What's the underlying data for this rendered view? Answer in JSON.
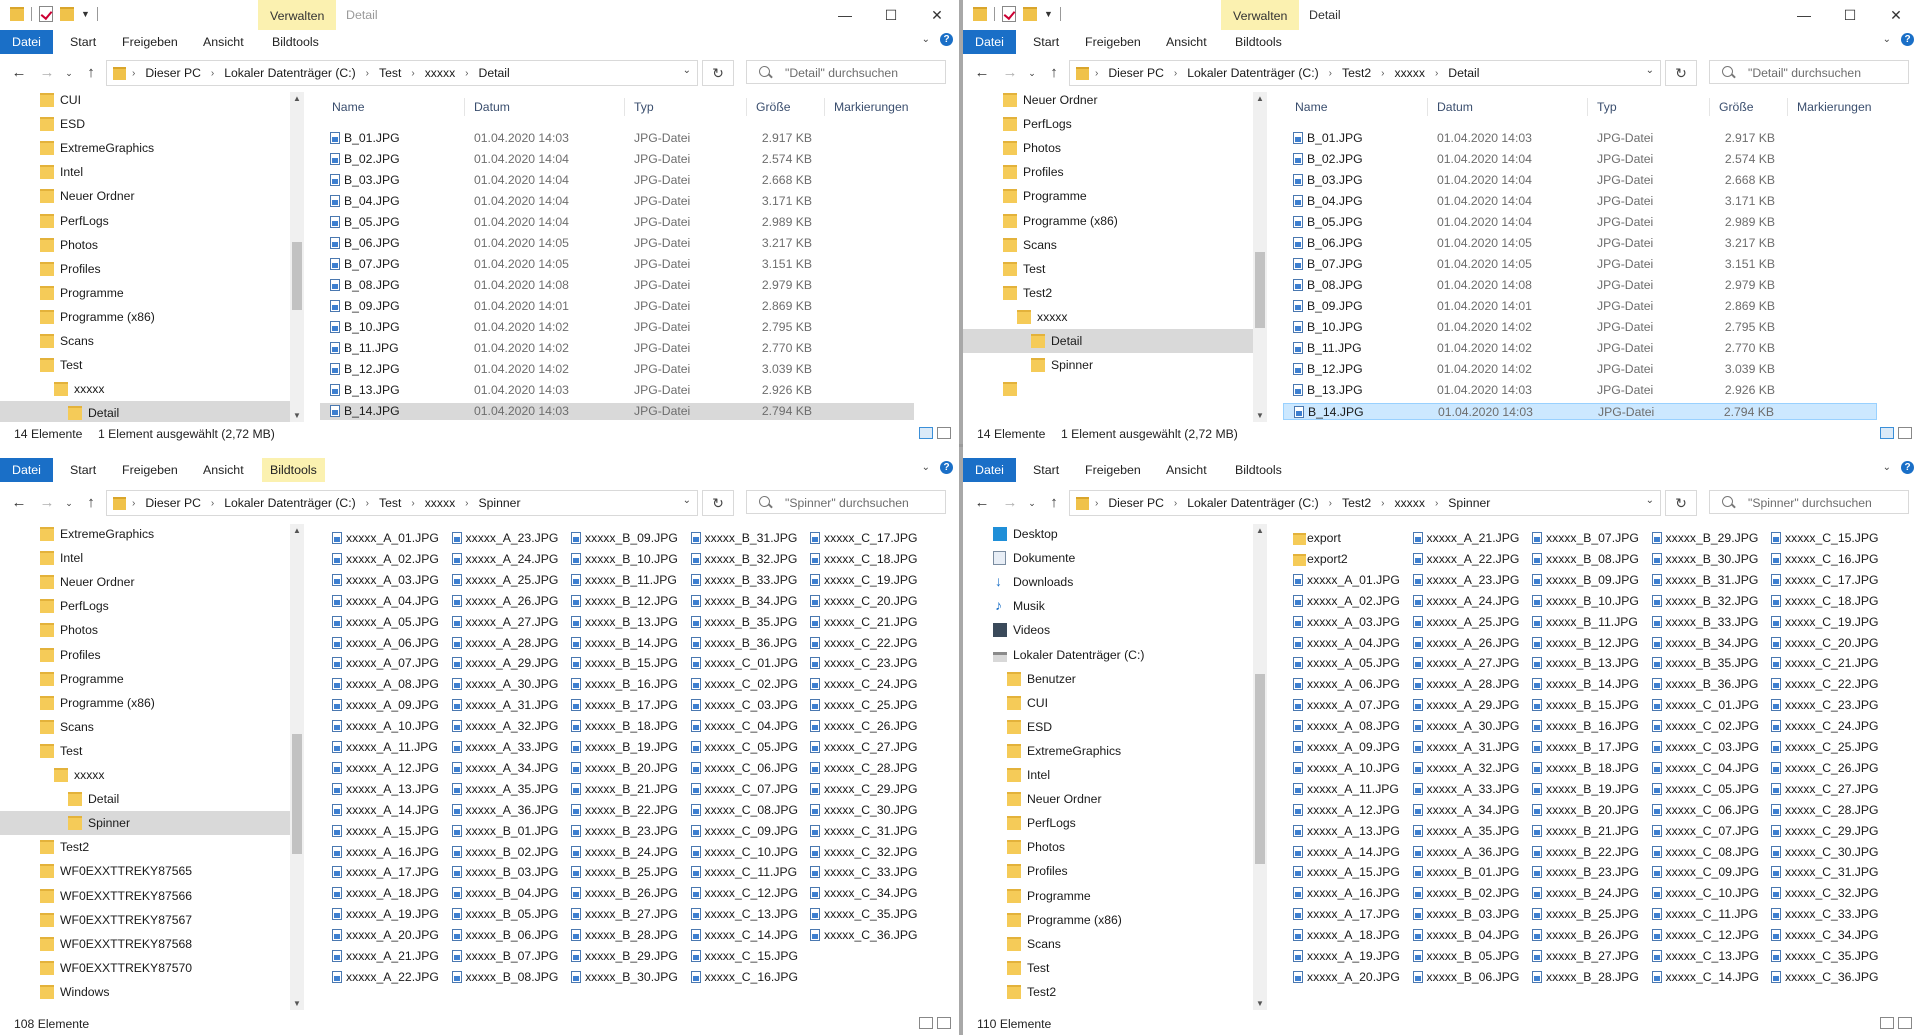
{
  "tabs": {
    "file": "Datei",
    "start": "Start",
    "share": "Freigeben",
    "view": "Ansicht",
    "tools": "Bildtools",
    "manage": "Verwalten"
  },
  "columns": {
    "name": "Name",
    "date": "Datum",
    "type": "Typ",
    "size": "Größe",
    "tags": "Markierungen"
  },
  "address_root": [
    "Dieser PC",
    "Lokaler Datenträger (C:)"
  ],
  "windows": [
    {
      "key": "tl",
      "title": "Detail",
      "address": [
        "Test",
        "xxxxx",
        "Detail"
      ],
      "search_placeholder": "\"Detail\" durchsuchen",
      "status_count": "14 Elemente",
      "status_selected": "1 Element ausgewählt (2,72 MB)",
      "nav": [
        {
          "label": "CUI",
          "indent": 0
        },
        {
          "label": "ESD",
          "indent": 0
        },
        {
          "label": "ExtremeGraphics",
          "indent": 0
        },
        {
          "label": "Intel",
          "indent": 0
        },
        {
          "label": "Neuer Ordner",
          "indent": 0
        },
        {
          "label": "PerfLogs",
          "indent": 0
        },
        {
          "label": "Photos",
          "indent": 0
        },
        {
          "label": "Profiles",
          "indent": 0
        },
        {
          "label": "Programme",
          "indent": 0
        },
        {
          "label": "Programme (x86)",
          "indent": 0
        },
        {
          "label": "Scans",
          "indent": 0
        },
        {
          "label": "Test",
          "indent": 0
        },
        {
          "label": "xxxxx",
          "indent": 1
        },
        {
          "label": "Detail",
          "indent": 2,
          "selected": true
        }
      ]
    },
    {
      "key": "tr",
      "title": "Detail",
      "address": [
        "Test2",
        "xxxxx",
        "Detail"
      ],
      "search_placeholder": "\"Detail\" durchsuchen",
      "status_count": "14 Elemente",
      "status_selected": "1 Element ausgewählt (2,72 MB)",
      "nav": [
        {
          "label": "Neuer Ordner",
          "indent": 0
        },
        {
          "label": "PerfLogs",
          "indent": 0
        },
        {
          "label": "Photos",
          "indent": 0
        },
        {
          "label": "Profiles",
          "indent": 0
        },
        {
          "label": "Programme",
          "indent": 0
        },
        {
          "label": "Programme (x86)",
          "indent": 0
        },
        {
          "label": "Scans",
          "indent": 0
        },
        {
          "label": "Test",
          "indent": 0
        },
        {
          "label": "Test2",
          "indent": 0
        },
        {
          "label": "xxxxx",
          "indent": 1
        },
        {
          "label": "Detail",
          "indent": 2,
          "selected": true
        },
        {
          "label": "Spinner",
          "indent": 2
        },
        {
          "label": "",
          "indent": 0
        }
      ]
    },
    {
      "key": "bl",
      "title": "Spinner",
      "address": [
        "Test",
        "xxxxx",
        "Spinner"
      ],
      "search_placeholder": "\"Spinner\" durchsuchen",
      "status_count": "108 Elemente",
      "status_selected": "",
      "nav": [
        {
          "label": "ExtremeGraphics",
          "indent": 0
        },
        {
          "label": "Intel",
          "indent": 0
        },
        {
          "label": "Neuer Ordner",
          "indent": 0
        },
        {
          "label": "PerfLogs",
          "indent": 0
        },
        {
          "label": "Photos",
          "indent": 0
        },
        {
          "label": "Profiles",
          "indent": 0
        },
        {
          "label": "Programme",
          "indent": 0
        },
        {
          "label": "Programme (x86)",
          "indent": 0
        },
        {
          "label": "Scans",
          "indent": 0
        },
        {
          "label": "Test",
          "indent": 0
        },
        {
          "label": "xxxxx",
          "indent": 1
        },
        {
          "label": "Detail",
          "indent": 2
        },
        {
          "label": "Spinner",
          "indent": 2,
          "selected": true
        },
        {
          "label": "Test2",
          "indent": 0
        },
        {
          "label": "WF0EXXTTREKY87565",
          "indent": 0
        },
        {
          "label": "WF0EXXTTREKY87566",
          "indent": 0
        },
        {
          "label": "WF0EXXTTREKY87567",
          "indent": 0
        },
        {
          "label": "WF0EXXTTREKY87568",
          "indent": 0
        },
        {
          "label": "WF0EXXTTREKY87570",
          "indent": 0
        },
        {
          "label": "Windows",
          "indent": 0
        }
      ]
    },
    {
      "key": "br",
      "title": "Spinner",
      "address": [
        "Test2",
        "xxxxx",
        "Spinner"
      ],
      "search_placeholder": "\"Spinner\" durchsuchen",
      "status_count": "110 Elemente",
      "status_selected": "",
      "nav": [
        {
          "label": "Desktop",
          "indent": 0,
          "icon": "desk"
        },
        {
          "label": "Dokumente",
          "indent": 0,
          "icon": "doc"
        },
        {
          "label": "Downloads",
          "indent": 0,
          "icon": "dl"
        },
        {
          "label": "Musik",
          "indent": 0,
          "icon": "mus"
        },
        {
          "label": "Videos",
          "indent": 0,
          "icon": "vid"
        },
        {
          "label": "Lokaler Datenträger (C:)",
          "indent": 0,
          "icon": "drv"
        },
        {
          "label": "Benutzer",
          "indent": 1
        },
        {
          "label": "CUI",
          "indent": 1
        },
        {
          "label": "ESD",
          "indent": 1
        },
        {
          "label": "ExtremeGraphics",
          "indent": 1
        },
        {
          "label": "Intel",
          "indent": 1
        },
        {
          "label": "Neuer Ordner",
          "indent": 1
        },
        {
          "label": "PerfLogs",
          "indent": 1
        },
        {
          "label": "Photos",
          "indent": 1
        },
        {
          "label": "Profiles",
          "indent": 1
        },
        {
          "label": "Programme",
          "indent": 1
        },
        {
          "label": "Programme (x86)",
          "indent": 1
        },
        {
          "label": "Scans",
          "indent": 1
        },
        {
          "label": "Test",
          "indent": 1
        },
        {
          "label": "Test2",
          "indent": 1
        }
      ]
    }
  ],
  "detail_files": [
    {
      "name": "B_01.JPG",
      "date": "01.04.2020 14:03",
      "type": "JPG-Datei",
      "size": "2.917 KB"
    },
    {
      "name": "B_02.JPG",
      "date": "01.04.2020 14:04",
      "type": "JPG-Datei",
      "size": "2.574 KB"
    },
    {
      "name": "B_03.JPG",
      "date": "01.04.2020 14:04",
      "type": "JPG-Datei",
      "size": "2.668 KB"
    },
    {
      "name": "B_04.JPG",
      "date": "01.04.2020 14:04",
      "type": "JPG-Datei",
      "size": "3.171 KB"
    },
    {
      "name": "B_05.JPG",
      "date": "01.04.2020 14:04",
      "type": "JPG-Datei",
      "size": "2.989 KB"
    },
    {
      "name": "B_06.JPG",
      "date": "01.04.2020 14:05",
      "type": "JPG-Datei",
      "size": "3.217 KB"
    },
    {
      "name": "B_07.JPG",
      "date": "01.04.2020 14:05",
      "type": "JPG-Datei",
      "size": "3.151 KB"
    },
    {
      "name": "B_08.JPG",
      "date": "01.04.2020 14:08",
      "type": "JPG-Datei",
      "size": "2.979 KB"
    },
    {
      "name": "B_09.JPG",
      "date": "01.04.2020 14:01",
      "type": "JPG-Datei",
      "size": "2.869 KB"
    },
    {
      "name": "B_10.JPG",
      "date": "01.04.2020 14:02",
      "type": "JPG-Datei",
      "size": "2.795 KB"
    },
    {
      "name": "B_11.JPG",
      "date": "01.04.2020 14:02",
      "type": "JPG-Datei",
      "size": "2.770 KB"
    },
    {
      "name": "B_12.JPG",
      "date": "01.04.2020 14:02",
      "type": "JPG-Datei",
      "size": "3.039 KB"
    },
    {
      "name": "B_13.JPG",
      "date": "01.04.2020 14:03",
      "type": "JPG-Datei",
      "size": "2.926 KB"
    },
    {
      "name": "B_14.JPG",
      "date": "01.04.2020 14:03",
      "type": "JPG-Datei",
      "size": "2.794 KB"
    }
  ],
  "spinner_bl": [
    [
      "xxxxx_A_01.JPG",
      "xxxxx_A_02.JPG",
      "xxxxx_A_03.JPG",
      "xxxxx_A_04.JPG",
      "xxxxx_A_05.JPG",
      "xxxxx_A_06.JPG",
      "xxxxx_A_07.JPG",
      "xxxxx_A_08.JPG",
      "xxxxx_A_09.JPG",
      "xxxxx_A_10.JPG",
      "xxxxx_A_11.JPG",
      "xxxxx_A_12.JPG",
      "xxxxx_A_13.JPG",
      "xxxxx_A_14.JPG",
      "xxxxx_A_15.JPG",
      "xxxxx_A_16.JPG",
      "xxxxx_A_17.JPG",
      "xxxxx_A_18.JPG",
      "xxxxx_A_19.JPG",
      "xxxxx_A_20.JPG",
      "xxxxx_A_21.JPG",
      "xxxxx_A_22.JPG"
    ],
    [
      "xxxxx_A_23.JPG",
      "xxxxx_A_24.JPG",
      "xxxxx_A_25.JPG",
      "xxxxx_A_26.JPG",
      "xxxxx_A_27.JPG",
      "xxxxx_A_28.JPG",
      "xxxxx_A_29.JPG",
      "xxxxx_A_30.JPG",
      "xxxxx_A_31.JPG",
      "xxxxx_A_32.JPG",
      "xxxxx_A_33.JPG",
      "xxxxx_A_34.JPG",
      "xxxxx_A_35.JPG",
      "xxxxx_A_36.JPG",
      "xxxxx_B_01.JPG",
      "xxxxx_B_02.JPG",
      "xxxxx_B_03.JPG",
      "xxxxx_B_04.JPG",
      "xxxxx_B_05.JPG",
      "xxxxx_B_06.JPG",
      "xxxxx_B_07.JPG",
      "xxxxx_B_08.JPG"
    ],
    [
      "xxxxx_B_09.JPG",
      "xxxxx_B_10.JPG",
      "xxxxx_B_11.JPG",
      "xxxxx_B_12.JPG",
      "xxxxx_B_13.JPG",
      "xxxxx_B_14.JPG",
      "xxxxx_B_15.JPG",
      "xxxxx_B_16.JPG",
      "xxxxx_B_17.JPG",
      "xxxxx_B_18.JPG",
      "xxxxx_B_19.JPG",
      "xxxxx_B_20.JPG",
      "xxxxx_B_21.JPG",
      "xxxxx_B_22.JPG",
      "xxxxx_B_23.JPG",
      "xxxxx_B_24.JPG",
      "xxxxx_B_25.JPG",
      "xxxxx_B_26.JPG",
      "xxxxx_B_27.JPG",
      "xxxxx_B_28.JPG",
      "xxxxx_B_29.JPG",
      "xxxxx_B_30.JPG"
    ],
    [
      "xxxxx_B_31.JPG",
      "xxxxx_B_32.JPG",
      "xxxxx_B_33.JPG",
      "xxxxx_B_34.JPG",
      "xxxxx_B_35.JPG",
      "xxxxx_B_36.JPG",
      "xxxxx_C_01.JPG",
      "xxxxx_C_02.JPG",
      "xxxxx_C_03.JPG",
      "xxxxx_C_04.JPG",
      "xxxxx_C_05.JPG",
      "xxxxx_C_06.JPG",
      "xxxxx_C_07.JPG",
      "xxxxx_C_08.JPG",
      "xxxxx_C_09.JPG",
      "xxxxx_C_10.JPG",
      "xxxxx_C_11.JPG",
      "xxxxx_C_12.JPG",
      "xxxxx_C_13.JPG",
      "xxxxx_C_14.JPG",
      "xxxxx_C_15.JPG",
      "xxxxx_C_16.JPG"
    ],
    [
      "xxxxx_C_17.JPG",
      "xxxxx_C_18.JPG",
      "xxxxx_C_19.JPG",
      "xxxxx_C_20.JPG",
      "xxxxx_C_21.JPG",
      "xxxxx_C_22.JPG",
      "xxxxx_C_23.JPG",
      "xxxxx_C_24.JPG",
      "xxxxx_C_25.JPG",
      "xxxxx_C_26.JPG",
      "xxxxx_C_27.JPG",
      "xxxxx_C_28.JPG",
      "xxxxx_C_29.JPG",
      "xxxxx_C_30.JPG",
      "xxxxx_C_31.JPG",
      "xxxxx_C_32.JPG",
      "xxxxx_C_33.JPG",
      "xxxxx_C_34.JPG",
      "xxxxx_C_35.JPG",
      "xxxxx_C_36.JPG"
    ]
  ],
  "spinner_br": [
    [
      "export",
      "export2",
      "xxxxx_A_01.JPG",
      "xxxxx_A_02.JPG",
      "xxxxx_A_03.JPG",
      "xxxxx_A_04.JPG",
      "xxxxx_A_05.JPG",
      "xxxxx_A_06.JPG",
      "xxxxx_A_07.JPG",
      "xxxxx_A_08.JPG",
      "xxxxx_A_09.JPG",
      "xxxxx_A_10.JPG",
      "xxxxx_A_11.JPG",
      "xxxxx_A_12.JPG",
      "xxxxx_A_13.JPG",
      "xxxxx_A_14.JPG",
      "xxxxx_A_15.JPG",
      "xxxxx_A_16.JPG",
      "xxxxx_A_17.JPG",
      "xxxxx_A_18.JPG",
      "xxxxx_A_19.JPG",
      "xxxxx_A_20.JPG"
    ],
    [
      "xxxxx_A_21.JPG",
      "xxxxx_A_22.JPG",
      "xxxxx_A_23.JPG",
      "xxxxx_A_24.JPG",
      "xxxxx_A_25.JPG",
      "xxxxx_A_26.JPG",
      "xxxxx_A_27.JPG",
      "xxxxx_A_28.JPG",
      "xxxxx_A_29.JPG",
      "xxxxx_A_30.JPG",
      "xxxxx_A_31.JPG",
      "xxxxx_A_32.JPG",
      "xxxxx_A_33.JPG",
      "xxxxx_A_34.JPG",
      "xxxxx_A_35.JPG",
      "xxxxx_A_36.JPG",
      "xxxxx_B_01.JPG",
      "xxxxx_B_02.JPG",
      "xxxxx_B_03.JPG",
      "xxxxx_B_04.JPG",
      "xxxxx_B_05.JPG",
      "xxxxx_B_06.JPG"
    ],
    [
      "xxxxx_B_07.JPG",
      "xxxxx_B_08.JPG",
      "xxxxx_B_09.JPG",
      "xxxxx_B_10.JPG",
      "xxxxx_B_11.JPG",
      "xxxxx_B_12.JPG",
      "xxxxx_B_13.JPG",
      "xxxxx_B_14.JPG",
      "xxxxx_B_15.JPG",
      "xxxxx_B_16.JPG",
      "xxxxx_B_17.JPG",
      "xxxxx_B_18.JPG",
      "xxxxx_B_19.JPG",
      "xxxxx_B_20.JPG",
      "xxxxx_B_21.JPG",
      "xxxxx_B_22.JPG",
      "xxxxx_B_23.JPG",
      "xxxxx_B_24.JPG",
      "xxxxx_B_25.JPG",
      "xxxxx_B_26.JPG",
      "xxxxx_B_27.JPG",
      "xxxxx_B_28.JPG"
    ],
    [
      "xxxxx_B_29.JPG",
      "xxxxx_B_30.JPG",
      "xxxxx_B_31.JPG",
      "xxxxx_B_32.JPG",
      "xxxxx_B_33.JPG",
      "xxxxx_B_34.JPG",
      "xxxxx_B_35.JPG",
      "xxxxx_B_36.JPG",
      "xxxxx_C_01.JPG",
      "xxxxx_C_02.JPG",
      "xxxxx_C_03.JPG",
      "xxxxx_C_04.JPG",
      "xxxxx_C_05.JPG",
      "xxxxx_C_06.JPG",
      "xxxxx_C_07.JPG",
      "xxxxx_C_08.JPG",
      "xxxxx_C_09.JPG",
      "xxxxx_C_10.JPG",
      "xxxxx_C_11.JPG",
      "xxxxx_C_12.JPG",
      "xxxxx_C_13.JPG",
      "xxxxx_C_14.JPG"
    ],
    [
      "xxxxx_C_15.JPG",
      "xxxxx_C_16.JPG",
      "xxxxx_C_17.JPG",
      "xxxxx_C_18.JPG",
      "xxxxx_C_19.JPG",
      "xxxxx_C_20.JPG",
      "xxxxx_C_21.JPG",
      "xxxxx_C_22.JPG",
      "xxxxx_C_23.JPG",
      "xxxxx_C_24.JPG",
      "xxxxx_C_25.JPG",
      "xxxxx_C_26.JPG",
      "xxxxx_C_27.JPG",
      "xxxxx_C_28.JPG",
      "xxxxx_C_29.JPG",
      "xxxxx_C_30.JPG",
      "xxxxx_C_31.JPG",
      "xxxxx_C_32.JPG",
      "xxxxx_C_33.JPG",
      "xxxxx_C_34.JPG",
      "xxxxx_C_35.JPG",
      "xxxxx_C_36.JPG"
    ]
  ],
  "colors": {
    "accent": "#1a6fc7",
    "context_tab": "#fbf1b0",
    "selection": "#cce8ff",
    "selection_inactive": "#d9d9d9",
    "folder": "#f5cb58"
  }
}
